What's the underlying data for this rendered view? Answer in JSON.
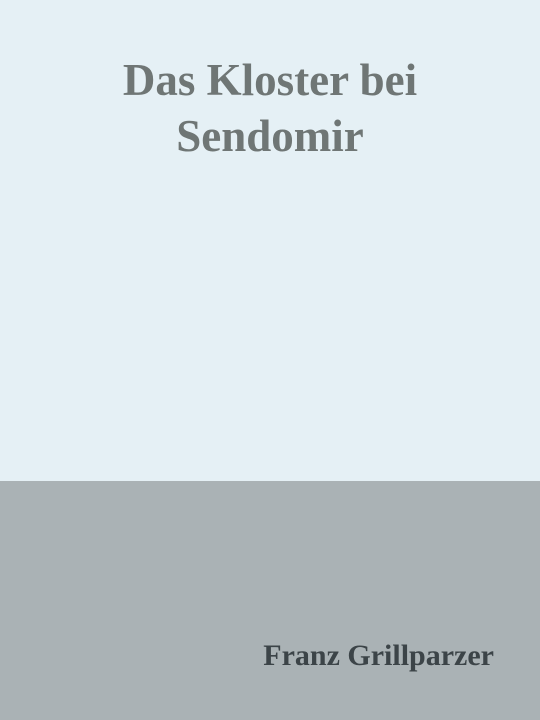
{
  "cover": {
    "title_lines": [
      "Das Kloster bei",
      "Sendomir"
    ],
    "author": "Franz Grillparzer"
  },
  "colors": {
    "top_background": "#e5f0f5",
    "bottom_background": "#aab2b5",
    "title_text": "#6f7675",
    "author_text": "#3c4448"
  }
}
